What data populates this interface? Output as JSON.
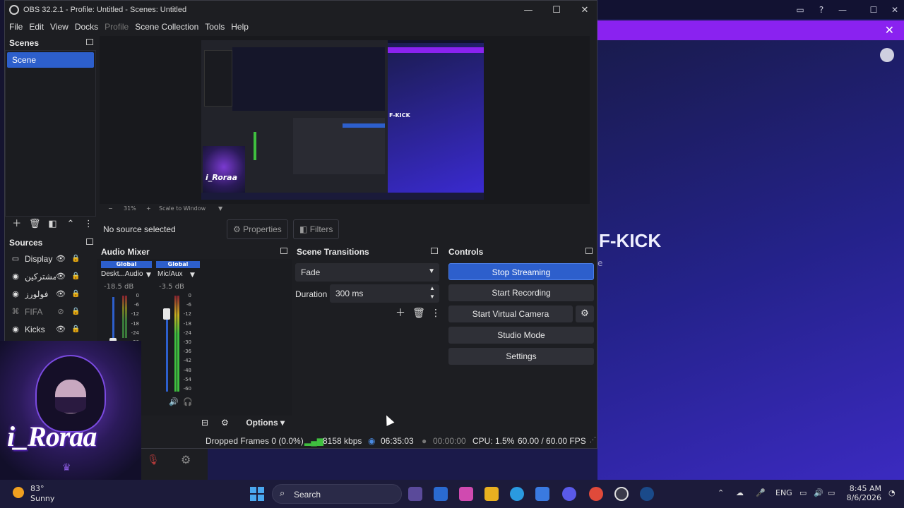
{
  "window": {
    "title": "OBS 32.2.1 - Profile: Untitled - Scenes: Untitled",
    "minimize": "—",
    "maximize": "☐",
    "close": "✕"
  },
  "menu": [
    "File",
    "Edit",
    "View",
    "Docks",
    "Profile",
    "Scene Collection",
    "Tools",
    "Help"
  ],
  "scenes": {
    "header": "Scenes",
    "items": [
      "Scene"
    ]
  },
  "sources": {
    "header": "Sources",
    "items": [
      {
        "name": "Display",
        "icon": "monitor-icon"
      },
      {
        "name": "المشتركين",
        "icon": "globe-icon"
      },
      {
        "name": "فولورز",
        "icon": "globe-icon"
      },
      {
        "name": "FIFA",
        "icon": "gamepad-icon",
        "hidden": true
      },
      {
        "name": "Kicks",
        "icon": "globe-icon"
      }
    ]
  },
  "preview": {
    "zoom": "31%",
    "scale_mode": "Scale to Window",
    "embedded_text": "F-KICK",
    "embedded_brand": "i_Roraa"
  },
  "context": {
    "no_source": "No source selected",
    "properties": "Properties",
    "filters": "Filters"
  },
  "audio_mixer": {
    "header": "Audio Mixer",
    "channels": [
      {
        "tag": "Global",
        "name": "Deskt...Audio",
        "db": "-18.5 dB",
        "level": 0.3
      },
      {
        "tag": "Global",
        "name": "Mic/Aux",
        "db": "-3.5 dB",
        "level": 0.85
      }
    ],
    "scale": [
      "0",
      "-6",
      "-12",
      "-18",
      "-24",
      "-30",
      "-36",
      "-42",
      "-48",
      "-54",
      "-60"
    ],
    "options": "Options"
  },
  "transitions": {
    "header": "Scene Transitions",
    "selected": "Fade",
    "duration_label": "Duration",
    "duration_value": "300 ms"
  },
  "controls": {
    "header": "Controls",
    "stop_streaming": "Stop Streaming",
    "start_recording": "Start Recording",
    "start_virtual_camera": "Start Virtual Camera",
    "studio_mode": "Studio Mode",
    "settings": "Settings"
  },
  "status": {
    "dropped_frames": "Dropped Frames 0 (0.0%)",
    "bitrate": "8158 kbps",
    "stream_time": "06:35:03",
    "record_time": "00:00:00",
    "cpu": "CPU: 1.5%",
    "fps": "60.00 / 60.00 FPS"
  },
  "background_app": {
    "title_text": "F-KICK",
    "sub_text": "e"
  },
  "overlay": {
    "brand": "i_Roraa"
  },
  "taskbar": {
    "weather_temp": "83°",
    "weather_cond": "Sunny",
    "search": "Search",
    "lang": "ENG",
    "time": "8:45 AM",
    "date": "8/6/2026"
  },
  "colors": {
    "accent": "#2d5fcc",
    "banner": "#8a22f0",
    "obs_bg": "#1d1e22"
  }
}
